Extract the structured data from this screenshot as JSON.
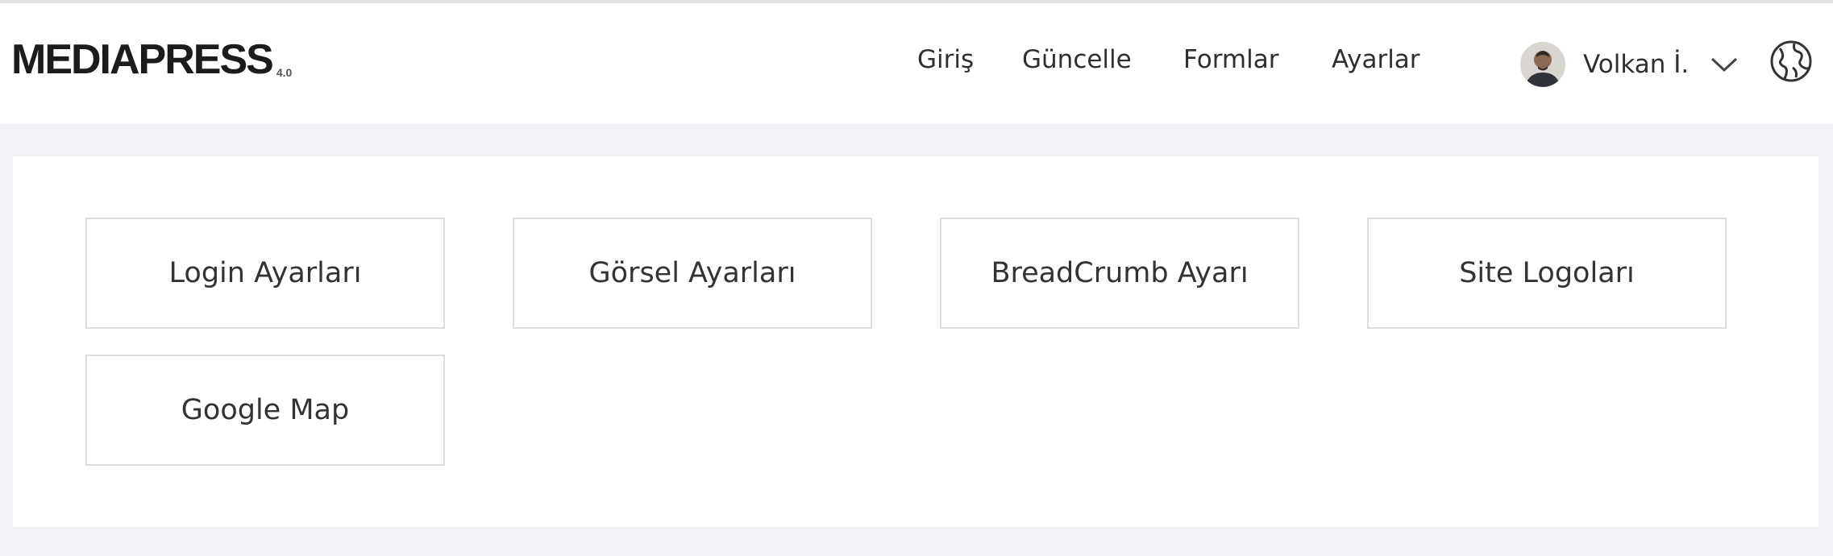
{
  "header": {
    "logo_text": "MEDIAPRESS",
    "logo_version": "4.0",
    "nav": [
      "Giriş",
      "Güncelle",
      "Formlar",
      "Ayarlar"
    ],
    "user_name": "Volkan İ.",
    "icons": {
      "avatar": "user-avatar",
      "chevron": "chevron-down-icon",
      "globe": "globe-icon"
    }
  },
  "settings_cards": [
    {
      "label": "Login Ayarları"
    },
    {
      "label": "Görsel Ayarları"
    },
    {
      "label": "BreadCrumb Ayarı"
    },
    {
      "label": "Site Logoları"
    },
    {
      "label": "Google Map"
    }
  ],
  "colors": {
    "page_bg": "#f1f2f7",
    "panel_bg": "#ffffff",
    "card_border": "#dcdcdc",
    "text": "#2f2f2f"
  }
}
